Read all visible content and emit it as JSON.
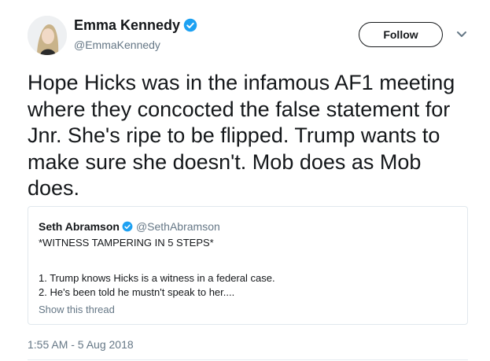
{
  "author": {
    "display_name": "Emma Kennedy",
    "handle": "@EmmaKennedy",
    "verified_icon": "verified-badge-icon"
  },
  "actions": {
    "follow_label": "Follow",
    "menu_icon": "chevron-down-icon"
  },
  "tweet": {
    "text": "Hope Hicks was in the infamous AF1 meeting where they concocted the false statement for Jnr. She's ripe to be flipped. Trump wants to make sure she doesn't. Mob does as Mob does.",
    "timestamp": "1:55 AM - 5 Aug 2018"
  },
  "quoted_tweet": {
    "display_name": "Seth Abramson",
    "handle": "@SethAbramson",
    "line1": "*WITNESS TAMPERING IN 5 STEPS*",
    "line2": "1. Trump knows Hicks is a witness in a federal case.",
    "line3": "2. He's been told he mustn't speak to her....",
    "show_thread": "Show this thread"
  },
  "colors": {
    "verified": "#1da1f2",
    "text": "#14171a",
    "secondary": "#657786",
    "border": "#e1e8ed"
  }
}
